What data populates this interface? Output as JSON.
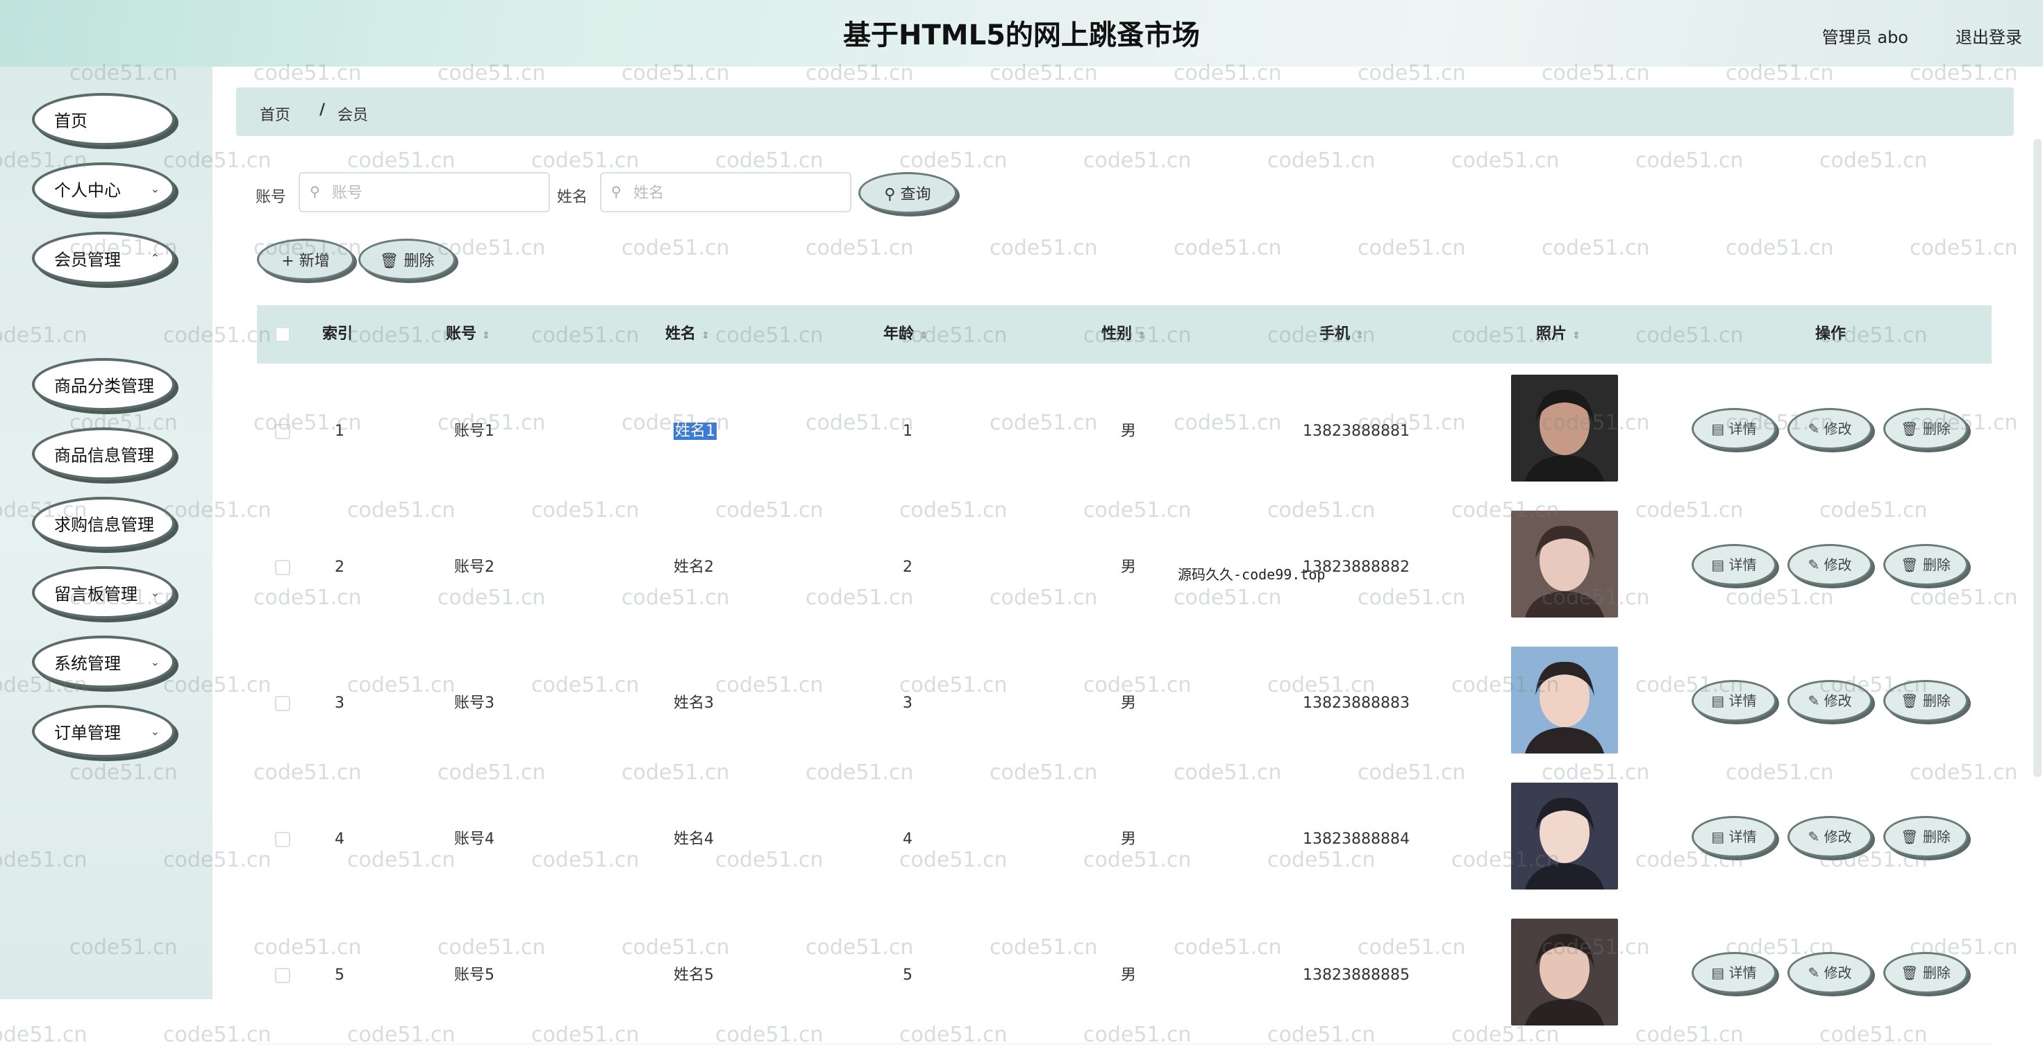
{
  "header": {
    "title": "基于HTML5的网上跳蚤市场",
    "admin_label": "管理员 abo",
    "logout_label": "退出登录"
  },
  "sidebar": {
    "items": [
      {
        "label": "首页",
        "has_chevron": false
      },
      {
        "label": "个人中心",
        "has_chevron": true
      },
      {
        "label": "会员管理",
        "has_chevron": true
      },
      {
        "label": "商品分类管理",
        "has_chevron": false
      },
      {
        "label": "商品信息管理",
        "has_chevron": false
      },
      {
        "label": "求购信息管理",
        "has_chevron": false
      },
      {
        "label": "留言板管理",
        "has_chevron": true
      },
      {
        "label": "系统管理",
        "has_chevron": true
      },
      {
        "label": "订单管理",
        "has_chevron": true
      }
    ],
    "submenu_label": "会员"
  },
  "breadcrumb": {
    "home": "首页",
    "separator": "/",
    "current": "会员"
  },
  "search": {
    "account_label": "账号",
    "account_placeholder": "账号",
    "name_label": "姓名",
    "name_placeholder": "姓名",
    "query_button": "查询"
  },
  "toolbar": {
    "add_button": "新增",
    "delete_button": "删除"
  },
  "table": {
    "columns": [
      "索引",
      "账号",
      "姓名",
      "年龄",
      "性别",
      "手机",
      "照片",
      "操作"
    ],
    "rows": [
      {
        "index": "1",
        "account": "账号1",
        "name": "姓名1",
        "age": "1",
        "gender": "男",
        "phone": "13823888881"
      },
      {
        "index": "2",
        "account": "账号2",
        "name": "姓名2",
        "age": "2",
        "gender": "男",
        "phone": "13823888882"
      },
      {
        "index": "3",
        "account": "账号3",
        "name": "姓名3",
        "age": "3",
        "gender": "男",
        "phone": "13823888883"
      },
      {
        "index": "4",
        "account": "账号4",
        "name": "姓名4",
        "age": "4",
        "gender": "男",
        "phone": "13823888884"
      },
      {
        "index": "5",
        "account": "账号5",
        "name": "姓名5",
        "age": "5",
        "gender": "男",
        "phone": "13823888885"
      }
    ],
    "actions": {
      "detail": "详情",
      "edit": "修改",
      "delete": "删除"
    }
  },
  "overlay_text": "源码久久-code99.top",
  "watermark": "code51.cn",
  "colors": {
    "selection": "#3b7bd6",
    "header_bg": "#d6e8e6"
  }
}
